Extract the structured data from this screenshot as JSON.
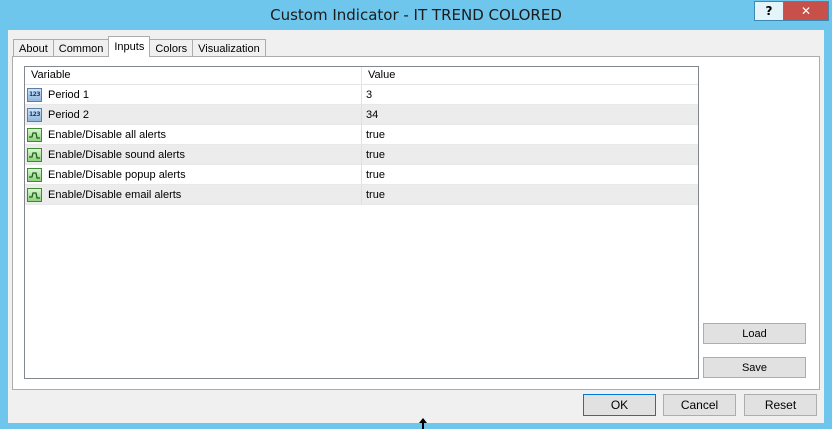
{
  "window": {
    "title": "Custom Indicator - IT TREND COLORED",
    "help_label": "?",
    "close_label": "✕"
  },
  "tabs": [
    {
      "label": "About"
    },
    {
      "label": "Common"
    },
    {
      "label": "Inputs",
      "active": true
    },
    {
      "label": "Colors"
    },
    {
      "label": "Visualization"
    }
  ],
  "grid": {
    "columns": {
      "variable": "Variable",
      "value": "Value"
    },
    "rows": [
      {
        "variable": "Period 1",
        "value": "3",
        "icon": "numeric-icon"
      },
      {
        "variable": "Period 2",
        "value": "34",
        "icon": "numeric-icon"
      },
      {
        "variable": "Enable/Disable all alerts",
        "value": "true",
        "icon": "boolean-icon"
      },
      {
        "variable": "Enable/Disable sound alerts",
        "value": "true",
        "icon": "boolean-icon"
      },
      {
        "variable": "Enable/Disable popup alerts",
        "value": "true",
        "icon": "boolean-icon"
      },
      {
        "variable": "Enable/Disable email alerts",
        "value": "true",
        "icon": "boolean-icon"
      }
    ]
  },
  "icons": {
    "numeric_text": "123"
  },
  "buttons": {
    "load": "Load",
    "save": "Save",
    "ok": "OK",
    "cancel": "Cancel",
    "reset": "Reset"
  },
  "colors": {
    "title_bar": "#6fc6ec",
    "close_button": "#c7504a",
    "ok_border": "#0078d7"
  }
}
